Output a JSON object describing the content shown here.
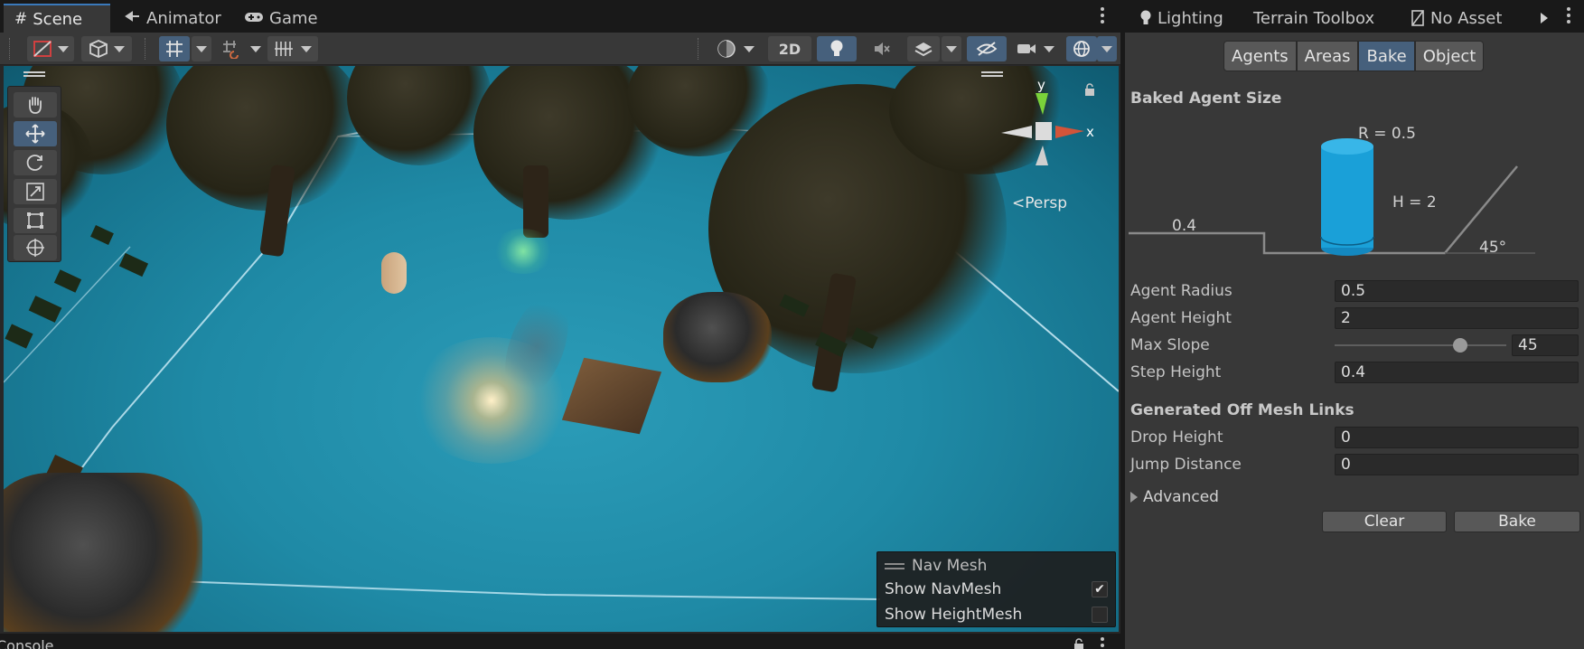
{
  "scene_window": {
    "tabs": [
      {
        "label": "Scene",
        "icon": "hash-icon",
        "active": true
      },
      {
        "label": "Animator",
        "icon": "animator-icon",
        "active": false
      },
      {
        "label": "Game",
        "icon": "gamepad-icon",
        "active": false
      }
    ],
    "toolbar": {
      "toggle_2d": "2D"
    },
    "viewport": {
      "persp_label": "Persp",
      "gizmo_axes": {
        "y": "y",
        "x": "x"
      }
    },
    "navmesh_overlay": {
      "title": "Nav Mesh",
      "show_navmesh_label": "Show NavMesh",
      "show_navmesh_checked": true,
      "show_heightmesh_label": "Show HeightMesh",
      "show_heightmesh_checked": false
    }
  },
  "bottom_panel": {
    "console_tab": "Console"
  },
  "right_panel": {
    "tabs": [
      {
        "label": "Lighting",
        "icon": "bulb-icon",
        "active": true
      },
      {
        "label": "Terrain Toolbox",
        "active": false
      },
      {
        "label": "No Asset",
        "icon": "no-asset-icon",
        "active": false
      }
    ],
    "nav_tabs": [
      {
        "label": "Agents",
        "active": false
      },
      {
        "label": "Areas",
        "active": false
      },
      {
        "label": "Bake",
        "active": true
      },
      {
        "label": "Object",
        "active": false
      }
    ],
    "baked_agent_size": {
      "title": "Baked Agent Size",
      "diagram": {
        "radius_label": "R = 0.5",
        "height_label": "H = 2",
        "step_label": "0.4",
        "slope_label": "45°"
      }
    },
    "fields": {
      "agent_radius": {
        "label": "Agent Radius",
        "value": "0.5"
      },
      "agent_height": {
        "label": "Agent Height",
        "value": "2"
      },
      "max_slope": {
        "label": "Max Slope",
        "value": "45",
        "slider_max": 60
      },
      "step_height": {
        "label": "Step Height",
        "value": "0.4"
      }
    },
    "off_mesh_links": {
      "title": "Generated Off Mesh Links",
      "drop_height": {
        "label": "Drop Height",
        "value": "0"
      },
      "jump_distance": {
        "label": "Jump Distance",
        "value": "0"
      }
    },
    "advanced_label": "Advanced",
    "buttons": {
      "clear": "Clear",
      "bake": "Bake"
    }
  },
  "colors": {
    "accent": "#46607c",
    "agent_cylinder": "#1aa0d8",
    "panel_bg": "#383838"
  }
}
